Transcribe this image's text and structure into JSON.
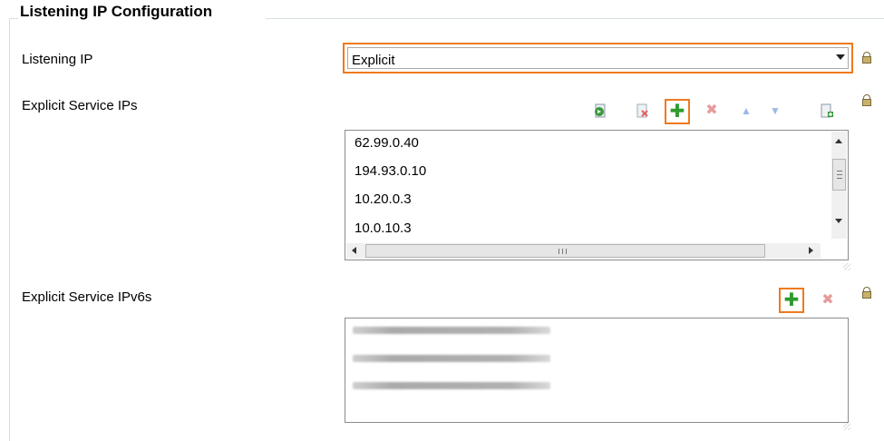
{
  "group": {
    "title": "Listening IP Configuration"
  },
  "listening_ip": {
    "label": "Listening IP",
    "value": "Explicit"
  },
  "explicit_ips": {
    "label": "Explicit Service IPs",
    "items": [
      "62.99.0.40",
      "194.93.0.10",
      "10.20.0.3",
      "10.0.10.3"
    ],
    "toolbar_icons": [
      "import-icon",
      "delete-doc-icon",
      "add-icon",
      "remove-icon",
      "move-up-icon",
      "move-down-icon",
      "new-doc-icon"
    ]
  },
  "explicit_ipv6": {
    "label": "Explicit Service IPv6s",
    "toolbar_icons": [
      "add-icon",
      "remove-icon"
    ]
  },
  "colors": {
    "highlight": "#f07a1c",
    "add_green": "#2e9b2e",
    "remove_red": "#e89a9a"
  }
}
